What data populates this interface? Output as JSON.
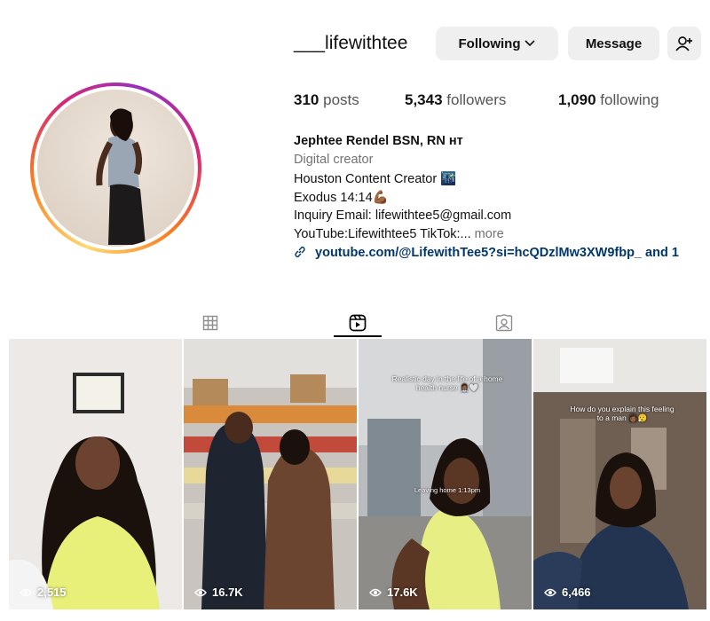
{
  "profile": {
    "username": "___lifewithtee",
    "following_label": "Following",
    "message_label": "Message",
    "posts_count": "310",
    "posts_label": "posts",
    "followers_count": "5,343",
    "followers_label": "followers",
    "following_count": "1,090",
    "following_label_stat": "following",
    "display_name": "Jephtee Rendel BSN, RN нт",
    "category": "Digital creator",
    "bio_lines": [
      "Houston Content Creator 🌃",
      "Exodus 14:14💪🏾",
      "Inquiry Email: lifewithtee5@gmail.com",
      "YouTube:Lifewithtee5 TikTok:..."
    ],
    "more_label": "more",
    "link": "youtube.com/@LifewithTee5?si=hcQDzlMw3XW9fbp_ and 1"
  },
  "reels": [
    {
      "views": "2,515",
      "overlay": ""
    },
    {
      "views": "16.7K",
      "overlay": ""
    },
    {
      "views": "17.6K",
      "overlay": "Realistic day in the life of a home health nurse 👩🏾‍⚕️🤍",
      "overlay2": "Leaving home 1:13pm"
    },
    {
      "views": "6,466",
      "overlay": "How do you explain this feeling to a man 👩🏾😮‍💨"
    }
  ],
  "colors": {
    "accent_link": "#00376b",
    "button_bg": "#efefef"
  }
}
